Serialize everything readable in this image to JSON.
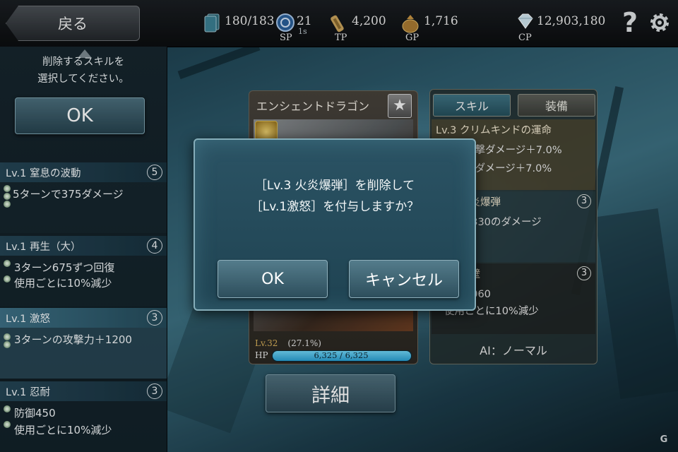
{
  "header": {
    "back_label": "戻る",
    "cards": {
      "value": "180/183",
      "icon": "card-stack-icon"
    },
    "sp": {
      "value": "21",
      "sub": "1s",
      "label": "SP",
      "icon": "sp-orb-icon"
    },
    "tp": {
      "value": "4,200",
      "label": "TP",
      "icon": "scroll-icon"
    },
    "gp": {
      "value": "1,716",
      "label": "GP",
      "icon": "money-bag-icon"
    },
    "cp": {
      "value": "12,903,180",
      "label": "CP",
      "icon": "diamond-icon"
    },
    "help_icon": "question-mark-icon",
    "settings_icon": "gear-icon"
  },
  "left_panel": {
    "prompt_line1": "削除するスキルを",
    "prompt_line2": "選択してください。",
    "ok_label": "OK",
    "skills": [
      {
        "title": "Lv.1 窒息の波動",
        "cost": "5",
        "lines": [
          "5ターンで375ダメージ"
        ]
      },
      {
        "title": "Lv.1 再生（大）",
        "cost": "4",
        "lines": [
          "3ターン675ずつ回復",
          "使用ごとに10%減少"
        ]
      },
      {
        "title": "Lv.1 激怒",
        "cost": "3",
        "lines": [
          "3ターンの攻撃力＋1200"
        ],
        "selected": true
      },
      {
        "title": "Lv.1 忍耐",
        "cost": "3",
        "lines": [
          "防御450",
          "使用ごとに10%減少"
        ]
      }
    ]
  },
  "card": {
    "name": "エンシェントドラゴン",
    "level": "Lv.32",
    "exp_pct": "(27.1%)",
    "hp_label": "HP",
    "hp_text": "6,325 / 6,325",
    "hp_fraction": 1.0,
    "detail_label": "詳細"
  },
  "right_panel": {
    "tab_skill": "スキル",
    "tab_equip": "装備",
    "sections": [
      {
        "head": "Lv.3 クリムキンドの運命",
        "lines": [
          "通常攻撃ダメージ＋7.0%",
          "スキルダメージ＋7.0%"
        ]
      },
      {
        "head": "Lv.3 火炎爆弾",
        "cost": "3",
        "lines": [
          "敵に2330のダメージ"
        ]
      },
      {
        "head": "鉄壁",
        "cost": "3",
        "lines": [
          "防御3060",
          "使用ごとに10%減少"
        ]
      }
    ],
    "ai_label": "AI：ノーマル"
  },
  "dialog": {
    "line1": "［Lv.3 火炎爆弾］を削除して",
    "line2": "［Lv.1激怒］を付与しますか？",
    "ok_label": "OK",
    "cancel_label": "キャンセル"
  },
  "colors": {
    "accent": "#2b5364",
    "hp": "#2a9ed0",
    "gold": "#d8b05a"
  }
}
